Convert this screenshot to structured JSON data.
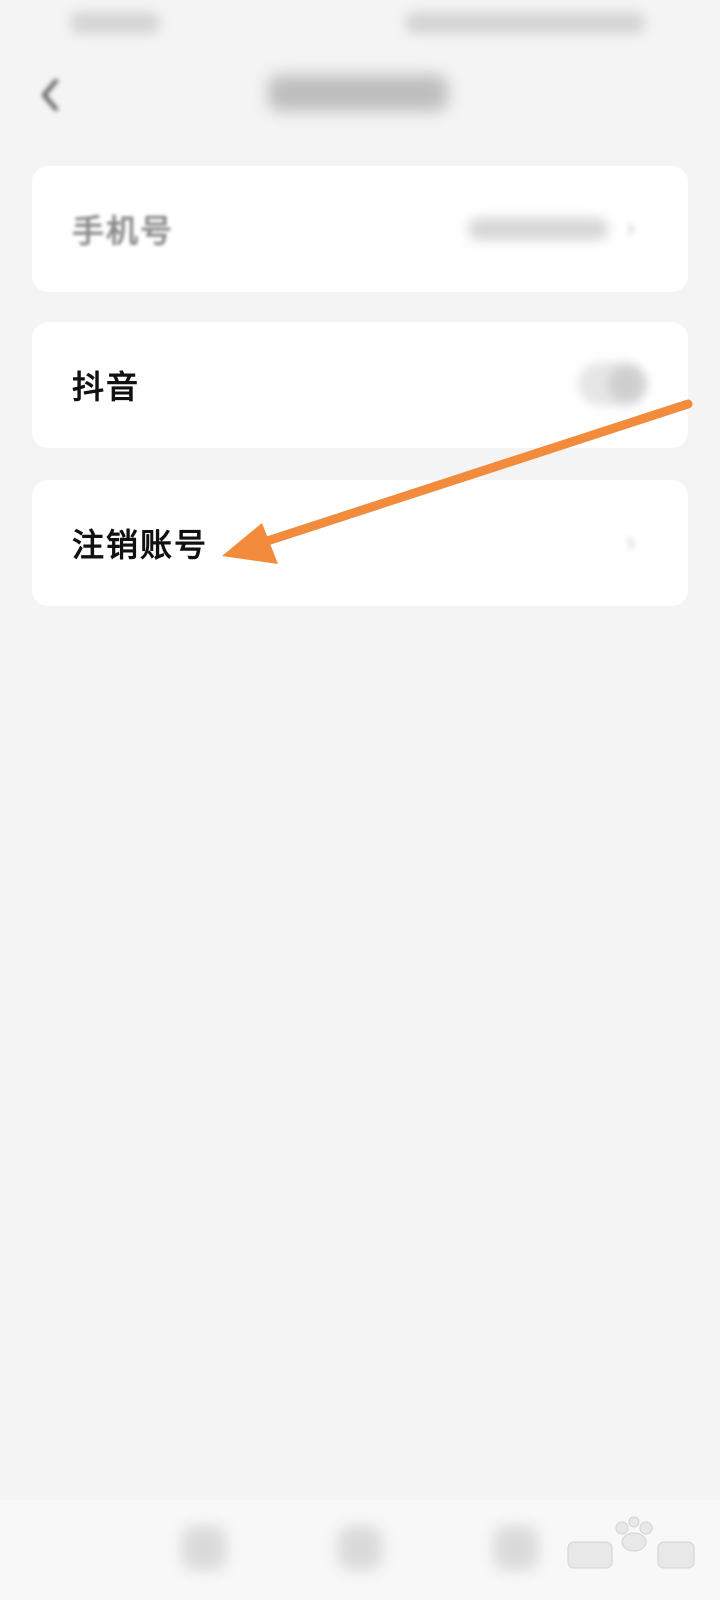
{
  "rows": {
    "phone": {
      "label": "手机号"
    },
    "douyin": {
      "label": "抖音"
    },
    "delete_account": {
      "label": "注销账号"
    }
  },
  "colors": {
    "background": "#f4f4f4",
    "card": "#ffffff",
    "arrow": "#f28b3b"
  },
  "icons": {
    "back": "back-arrow-icon",
    "chevron": "chevron-right-icon",
    "toggle": "toggle-switch",
    "arrow": "annotation-arrow"
  }
}
